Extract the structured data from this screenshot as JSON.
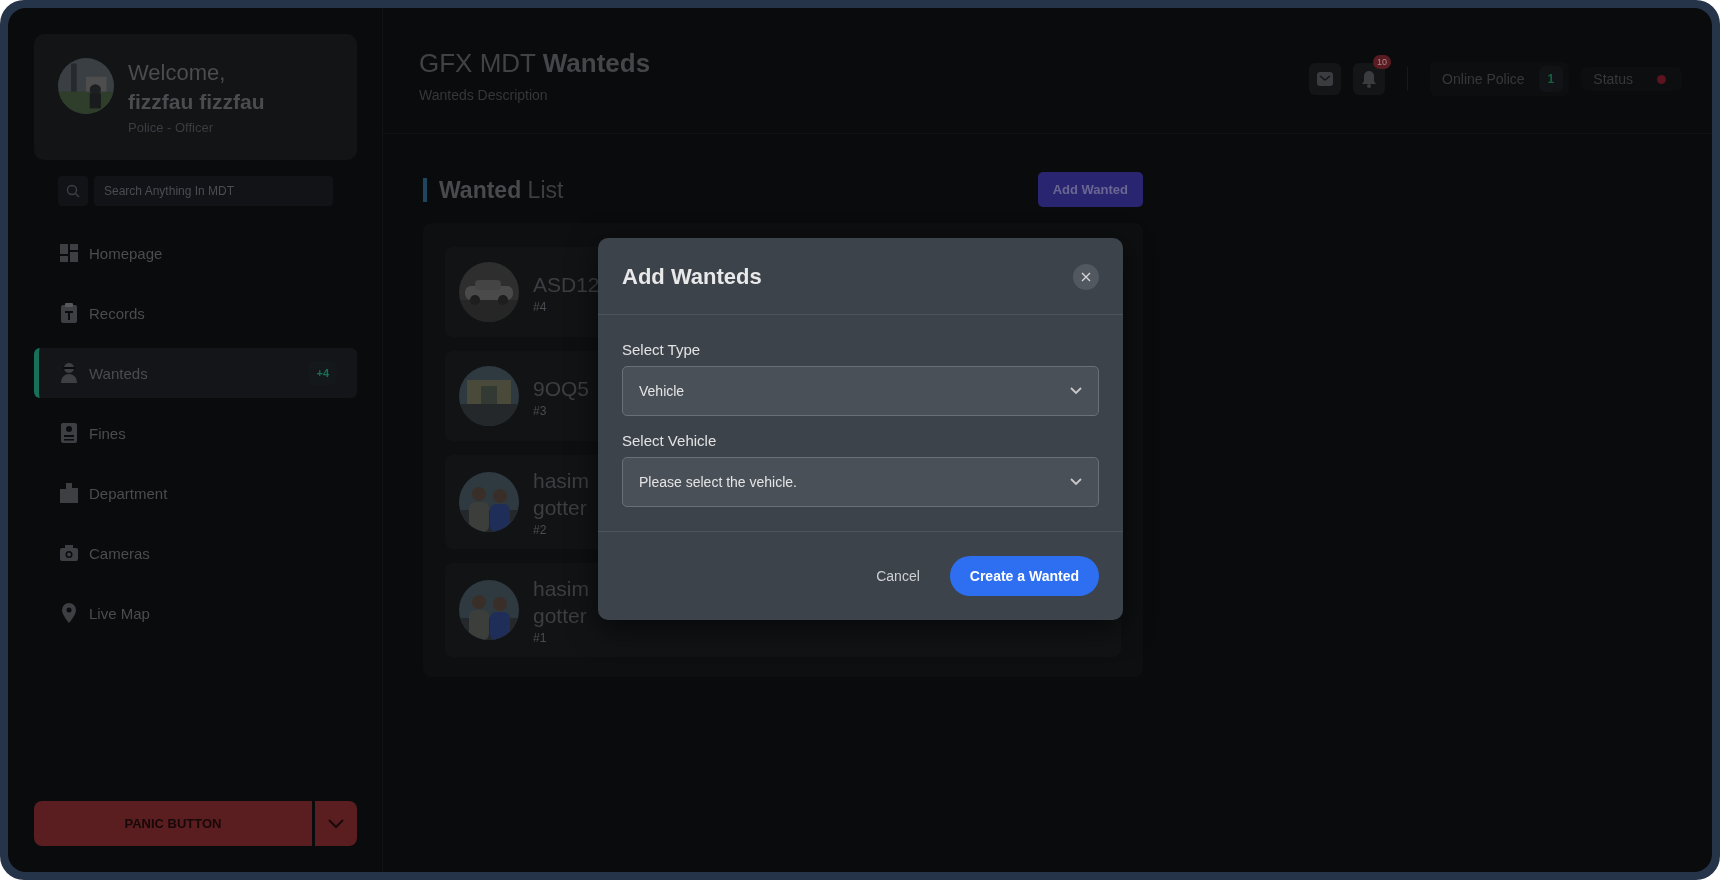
{
  "sidebar": {
    "profile": {
      "greeting": "Welcome,",
      "name": "fizzfau fizzfau",
      "role": "Police - Officer"
    },
    "search": {
      "placeholder": "Search Anything In MDT"
    },
    "nav": [
      {
        "label": "Homepage",
        "selected": false
      },
      {
        "label": "Records",
        "selected": false
      },
      {
        "label": "Wanteds",
        "selected": true,
        "badge": "+4"
      },
      {
        "label": "Fines",
        "selected": false
      },
      {
        "label": "Department",
        "selected": false
      },
      {
        "label": "Cameras",
        "selected": false
      },
      {
        "label": "Live Map",
        "selected": false
      }
    ],
    "panic_button": {
      "label": "PANIC BUTTON"
    }
  },
  "header": {
    "title": "GFX MDT **Wanteds**",
    "description": "Wanteds Description",
    "notification_count": "10",
    "online_police": {
      "label": "Online Police",
      "count": "1"
    },
    "status": {
      "label": "Status"
    }
  },
  "wanted_list": {
    "heading": "**Wanted** List",
    "add_button": "Add Wanted",
    "rows": [
      {
        "name_lines": [
          "ASD12"
        ],
        "number": "#4"
      },
      {
        "name_lines": [
          "9OQ5"
        ],
        "number": "#3"
      },
      {
        "name_lines": [
          "hasim",
          "gotter"
        ],
        "number": "#2"
      },
      {
        "name_lines": [
          "hasim",
          "gotter"
        ],
        "number": "#1"
      }
    ]
  },
  "modal": {
    "title": "Add Wanteds",
    "fields": [
      {
        "label": "Select Type",
        "value": "Vehicle"
      },
      {
        "label": "Select Vehicle",
        "placeholder": "Please select the vehicle."
      }
    ],
    "cancel": "Cancel",
    "submit": "Create a Wanted"
  }
}
